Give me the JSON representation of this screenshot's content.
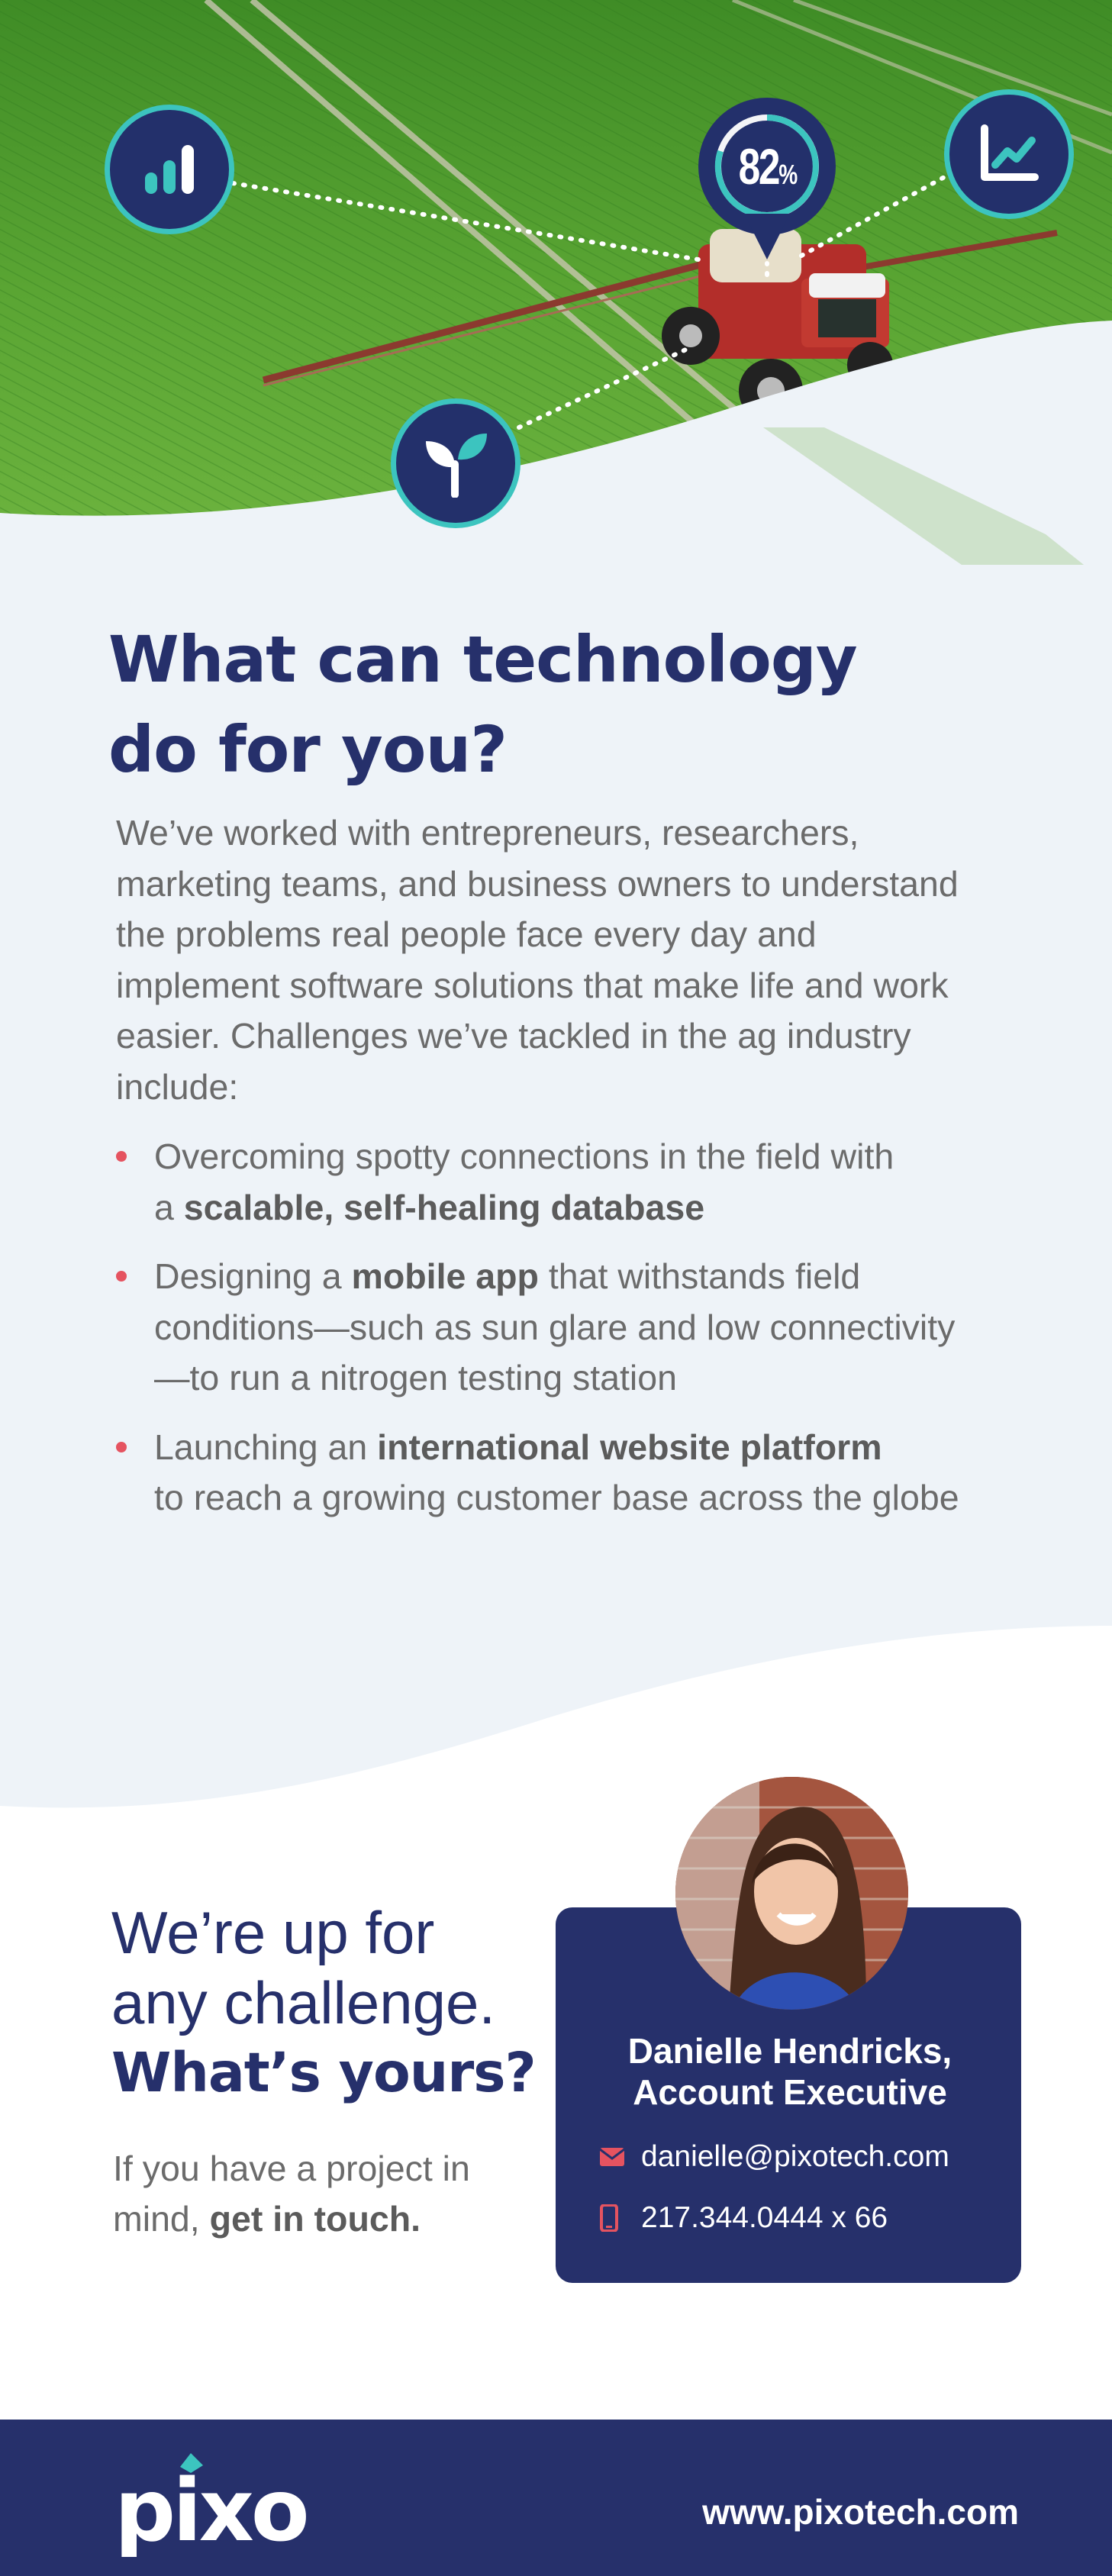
{
  "hero": {
    "stat_value": "82",
    "stat_unit": "%",
    "icons": [
      "bar-chart-icon",
      "percentage-icon",
      "line-chart-icon",
      "sprout-icon"
    ]
  },
  "main": {
    "headline_line1": "What can technology",
    "headline_line2": "do for you?",
    "intro_lines": [
      "We’ve worked with entrepreneurs, researchers,",
      "marketing teams, and business owners to understand",
      "the problems real people face every day and",
      "implement software solutions that make life and work",
      "easier. Challenges we’ve tackled in the ag industry",
      "include:"
    ],
    "bullets": [
      {
        "l1_pre": "Overcoming spotty connections in the field with",
        "l2_pre": "a ",
        "l2_bold": "scalable, self-healing database"
      },
      {
        "l1_pre": "Designing a ",
        "l1_bold": "mobile app",
        "l1_post": " that withstands field",
        "l2": "conditions—such as sun glare and low connectivity",
        "l3": "—to run a nitrogen testing station"
      },
      {
        "l1_pre": "Launching an ",
        "l1_bold": "international website platform",
        "l2": "to reach a growing customer base across the globe"
      }
    ]
  },
  "challenge": {
    "line1": "We’re up for",
    "line2": "any challenge.",
    "line3": "What’s yours?",
    "cta_line1": "If you have a project in",
    "cta_line2_pre": "mind, ",
    "cta_line2_bold": "get in touch."
  },
  "contact": {
    "name_line1": "Danielle Hendricks,",
    "name_line2": "Account Executive",
    "email": "danielle@pixotech.com",
    "phone": "217.344.0444 x 66"
  },
  "footer": {
    "logo_text": "pixo",
    "url": "www.pixotech.com"
  },
  "colors": {
    "navy": "#26306b",
    "teal": "#3cc4bf",
    "coral": "#e55360",
    "field_green": "#4f9a2a",
    "background": "#eef3f8"
  }
}
